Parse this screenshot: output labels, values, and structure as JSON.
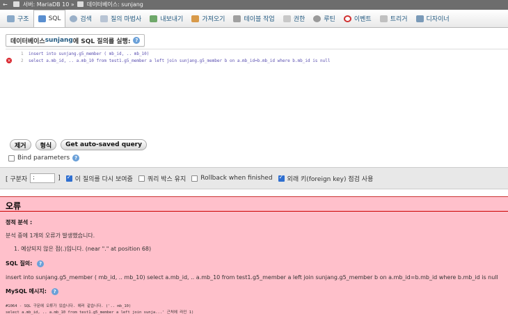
{
  "breadcrumb": {
    "server": "서버: MariaDB 10",
    "separator": "»",
    "database": "데이터베이스: sunjang"
  },
  "tabs": [
    {
      "label": "구조",
      "icon": "structure-icon",
      "active": false
    },
    {
      "label": "SQL",
      "icon": "sql-icon",
      "active": true
    },
    {
      "label": "검색",
      "icon": "search-icon",
      "active": false
    },
    {
      "label": "질의 마법사",
      "icon": "query-wizard-icon",
      "active": false
    },
    {
      "label": "내보내기",
      "icon": "export-icon",
      "active": false
    },
    {
      "label": "가져오기",
      "icon": "import-icon",
      "active": false
    },
    {
      "label": "테이블 작업",
      "icon": "wrench-icon",
      "active": false
    },
    {
      "label": "권한",
      "icon": "privileges-icon",
      "active": false
    },
    {
      "label": "루틴",
      "icon": "routines-icon",
      "active": false
    },
    {
      "label": "이벤트",
      "icon": "events-icon",
      "active": false
    },
    {
      "label": "트리거",
      "icon": "triggers-icon",
      "active": false
    },
    {
      "label": "디자이너",
      "icon": "designer-icon",
      "active": false
    }
  ],
  "query_header": {
    "prefix": "데이터베이스 ",
    "db": "sunjang",
    "suffix": "에 SQL 질의를 실행:"
  },
  "editor": {
    "lines": [
      {
        "num": "1",
        "text": "insert into sunjang.g5_member ( mb_id, .. mb_10)"
      },
      {
        "num": "2",
        "text": "select a.mb_id, .. a.mb_10 from test1.g5_member a left join sunjang.g5_member b on a.mb_id=b.mb_id where b.mb_id is null"
      }
    ]
  },
  "buttons": {
    "clear": "제거",
    "format": "형식",
    "autosaved": "Get auto-saved query"
  },
  "bind_params": {
    "label": "Bind parameters",
    "checked": false
  },
  "options": {
    "delimiter_label": "[ 구분자",
    "delimiter_value": ";",
    "delimiter_close": "]",
    "show_again": {
      "label": "이 질의를 다시 보여줌",
      "checked": true
    },
    "keep_box": {
      "label": "쿼리 박스 유지",
      "checked": false
    },
    "rollback": {
      "label": "Rollback when finished",
      "checked": false
    },
    "fk_check": {
      "label": "외래 키(foreign key) 점검 사용",
      "checked": true
    }
  },
  "error": {
    "title": "오류",
    "static_analysis": "정적 분석 :",
    "found": "분석 중에 1개의 오류가 발생했습니다.",
    "item": "1. 예상되지 않은 점(.)입니다. (near \".\" at position 68)",
    "sql_label": "SQL 질의:",
    "sql_text": "insert into sunjang.g5_member ( mb_id, .. mb_10) select a.mb_id, .. a.mb_10 from test1.g5_member a left join sunjang.g5_member b on a.mb_id=b.mb_id where b.mb_id is null",
    "mysql_label": "MySQL 메시지:",
    "mysql_line1": "#1064 - SQL 구문에 오류가 있습니다. 에러 같습니다. ('.. mb_10)",
    "mysql_line2": "select a.mb_id, .. a.mb_10 from test1.g5_member a left join sunja...' 근처에 라인 1)"
  },
  "colors": {
    "accent": "#235a81",
    "error_bg": "#ffc0cb",
    "error_icon": "#d8222a",
    "checkbox": "#2f6fd0"
  }
}
